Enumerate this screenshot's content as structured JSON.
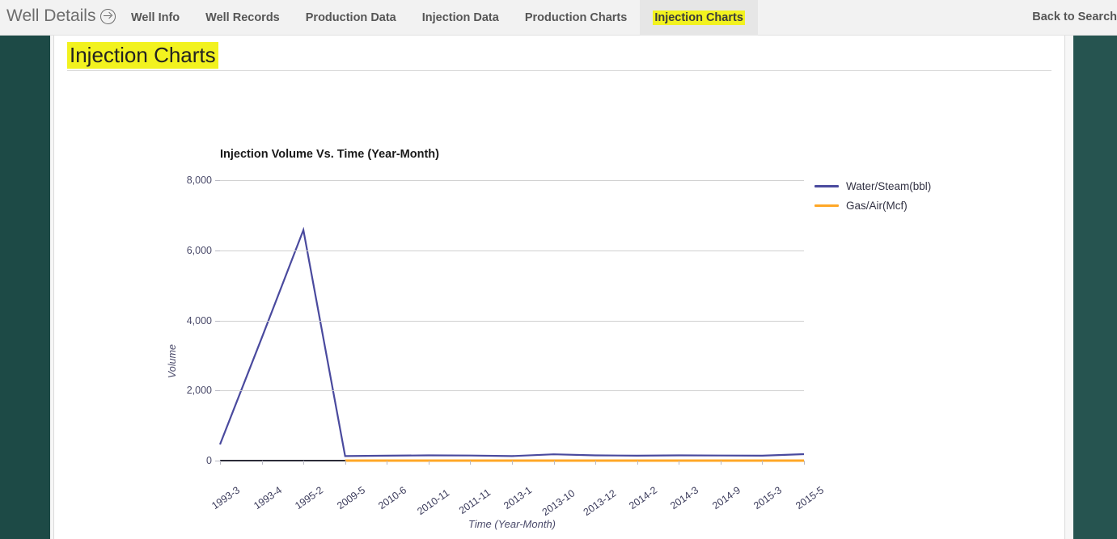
{
  "navbar": {
    "brand": "Well Details",
    "brand_icon": "arrow-circle-right-icon",
    "tabs": [
      {
        "label": "Well Info",
        "active": false
      },
      {
        "label": "Well Records",
        "active": false
      },
      {
        "label": "Production Data",
        "active": false
      },
      {
        "label": "Injection Data",
        "active": false
      },
      {
        "label": "Production Charts",
        "active": false
      },
      {
        "label": "Injection Charts",
        "active": true
      }
    ],
    "back_link": "Back to Search"
  },
  "page": {
    "title": "Injection Charts",
    "highlight_color": "#f2f21f",
    "sidebar_color": "#1d4a46"
  },
  "chart_data": {
    "type": "line",
    "title": "Injection Volume Vs. Time (Year-Month)",
    "xlabel": "Time (Year-Month)",
    "ylabel": "Volume",
    "grid": true,
    "legend_position": "right",
    "ylim": [
      0,
      8000
    ],
    "yticks": [
      0,
      2000,
      4000,
      6000,
      8000
    ],
    "ytick_labels": [
      "0",
      "2,000",
      "4,000",
      "6,000",
      "8,000"
    ],
    "categories": [
      "1993-3",
      "1993-4",
      "1995-2",
      "2009-5",
      "2010-6",
      "2010-11",
      "2011-11",
      "2013-1",
      "2013-10",
      "2013-12",
      "2014-2",
      "2014-3",
      "2014-9",
      "2015-3",
      "2015-5"
    ],
    "series": [
      {
        "name": "Water/Steam(bbl)",
        "color": "#4a4a9e",
        "values": [
          460,
          3500,
          6580,
          130,
          140,
          150,
          145,
          130,
          180,
          150,
          140,
          150,
          145,
          140,
          185
        ]
      },
      {
        "name": "Gas/Air(Mcf)",
        "color": "#ffa726",
        "values": [
          null,
          null,
          null,
          0,
          0,
          0,
          0,
          0,
          0,
          0,
          0,
          0,
          0,
          0,
          0
        ]
      }
    ]
  }
}
